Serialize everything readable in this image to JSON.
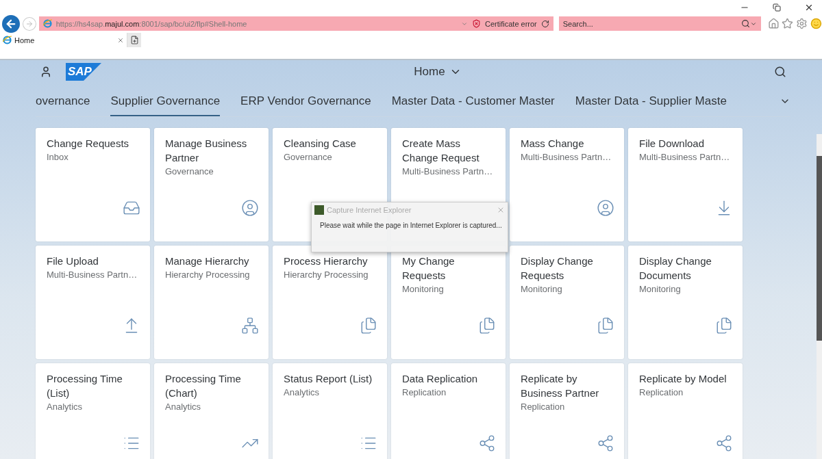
{
  "browser": {
    "url": "https://hs4sap.**majul.com**:8001/sap/bc/ui2/flp#Shell-home",
    "certificate": "Certificate error",
    "search": {
      "placeholder": "Search..."
    },
    "tabs": [
      {
        "label": "Home",
        "selected": true
      }
    ]
  },
  "shell": {
    "logo": "SAP",
    "title": "Home",
    "groups": [
      {
        "label": "overnance",
        "selected": false
      },
      {
        "label": "Supplier Governance",
        "selected": true
      },
      {
        "label": "ERP Vendor Governance",
        "selected": false
      },
      {
        "label": "Master Data - Customer Master",
        "selected": false
      },
      {
        "label": "Master Data - Supplier Maste",
        "selected": false
      }
    ],
    "tiles": [
      {
        "title": "Change Requests",
        "subtitle": "Inbox",
        "kind": "inbox"
      },
      {
        "title": "Manage Business Partner",
        "subtitle": "Governance",
        "kind": "person"
      },
      {
        "title": "Cleansing Case",
        "subtitle": "Governance",
        "kind": "covered"
      },
      {
        "title": "Create Mass Change Request",
        "subtitle": "Multi-Business Partn…",
        "kind": "covered"
      },
      {
        "title": "Mass Change",
        "subtitle": "Multi-Business Partn…",
        "kind": "person"
      },
      {
        "title": "File Download",
        "subtitle": "Multi-Business Partn…",
        "kind": "download"
      },
      {
        "title": "File Upload",
        "subtitle": "Multi-Business Partn…",
        "kind": "upload"
      },
      {
        "title": "Manage Hierarchy",
        "subtitle": "Hierarchy Processing",
        "kind": "hierarchy"
      },
      {
        "title": "Process Hierarchy",
        "subtitle": "Hierarchy Processing",
        "kind": "documents"
      },
      {
        "title": "My Change Requests",
        "subtitle": "Monitoring",
        "kind": "documents"
      },
      {
        "title": "Display Change Requests",
        "subtitle": "Monitoring",
        "kind": "documents"
      },
      {
        "title": "Display Change Documents",
        "subtitle": "Monitoring",
        "kind": "documents"
      },
      {
        "title": "Processing Time (List)",
        "subtitle": "Analytics",
        "kind": "list"
      },
      {
        "title": "Processing Time (Chart)",
        "subtitle": "Analytics",
        "kind": "chart"
      },
      {
        "title": "Status Report (List)",
        "subtitle": "Analytics",
        "kind": "list"
      },
      {
        "title": "Data Replication",
        "subtitle": "Replication",
        "kind": "share"
      },
      {
        "title": "Replicate by Business Partner",
        "subtitle": "Replication",
        "kind": "share"
      },
      {
        "title": "Replicate by Model",
        "subtitle": "Replication",
        "kind": "share"
      }
    ]
  },
  "dialog": {
    "title": "Capture Internet Explorer",
    "message": "Please wait while the page in Internet Explorer is captured..."
  }
}
